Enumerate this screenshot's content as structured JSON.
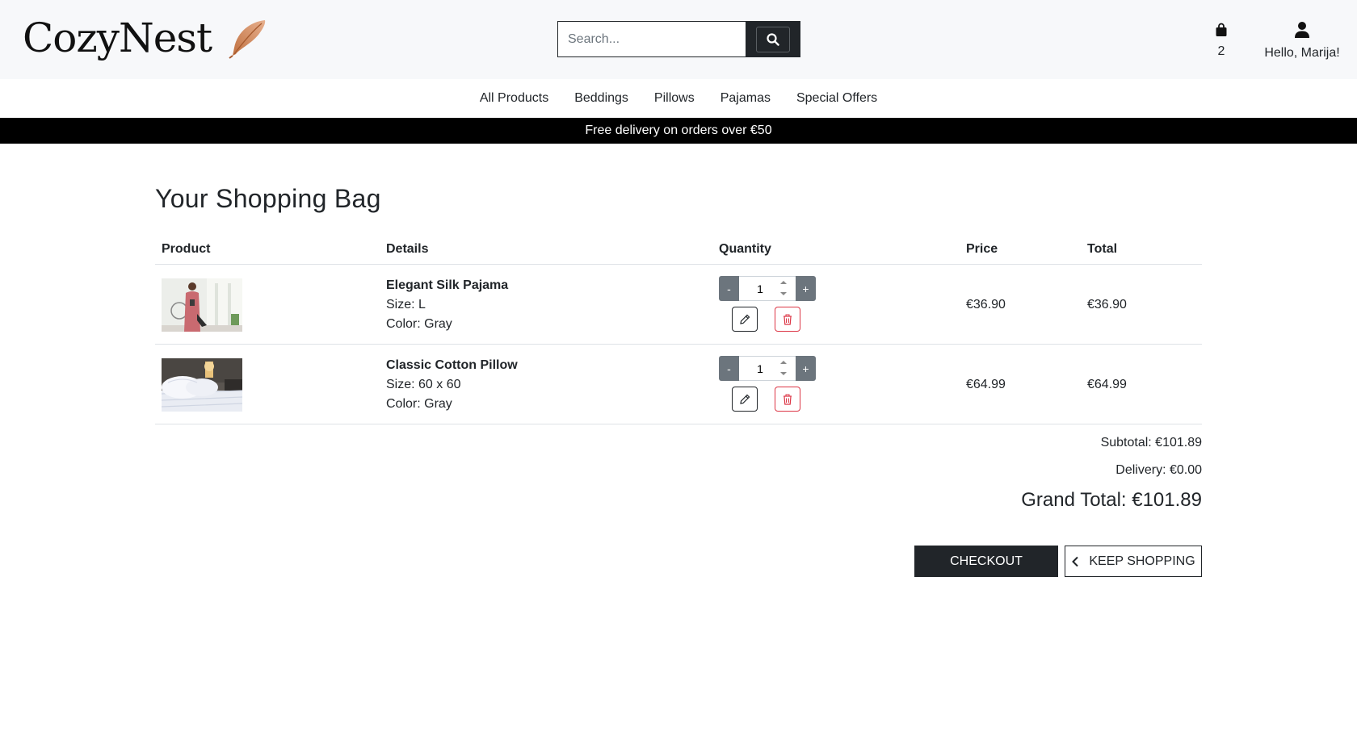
{
  "header": {
    "logo_text": "CozyNest",
    "search_placeholder": "Search...",
    "bag_count": "2",
    "account_label": "Hello, Marija!"
  },
  "nav": [
    "All Products",
    "Beddings",
    "Pillows",
    "Pajamas",
    "Special Offers"
  ],
  "promo_banner": "Free delivery on orders over €50",
  "page_title": "Your Shopping Bag",
  "table": {
    "headers": [
      "Product",
      "Details",
      "Quantity",
      "Price",
      "Total"
    ],
    "rows": [
      {
        "name": "Elegant Silk Pajama",
        "size": "Size: L",
        "color": "Color: Gray",
        "quantity": "1",
        "price": "€36.90",
        "total": "€36.90",
        "image": "woman-pajama"
      },
      {
        "name": "Classic Cotton Pillow",
        "size": "Size: 60 x 60",
        "color": "Color: Gray",
        "quantity": "1",
        "price": "€64.99",
        "total": "€64.99",
        "image": "pillows-bed"
      }
    ]
  },
  "summary": {
    "subtotal": "Subtotal: €101.89",
    "delivery": "Delivery: €0.00",
    "grand_total": "Grand Total: €101.89"
  },
  "buttons": {
    "checkout": "CHECKOUT",
    "keep_shopping": "KEEP SHOPPING"
  },
  "icons": {
    "logo": "feather-icon",
    "search": "search-icon",
    "bag": "shopping-bag-icon",
    "account": "user-icon",
    "edit": "pencil-icon",
    "delete": "trash-icon",
    "back": "chevron-left-icon"
  },
  "colors": {
    "primary_dark": "#212529",
    "danger": "#dc3545",
    "qty_button": "#6c757d",
    "logo_feather": "#d08a63"
  }
}
